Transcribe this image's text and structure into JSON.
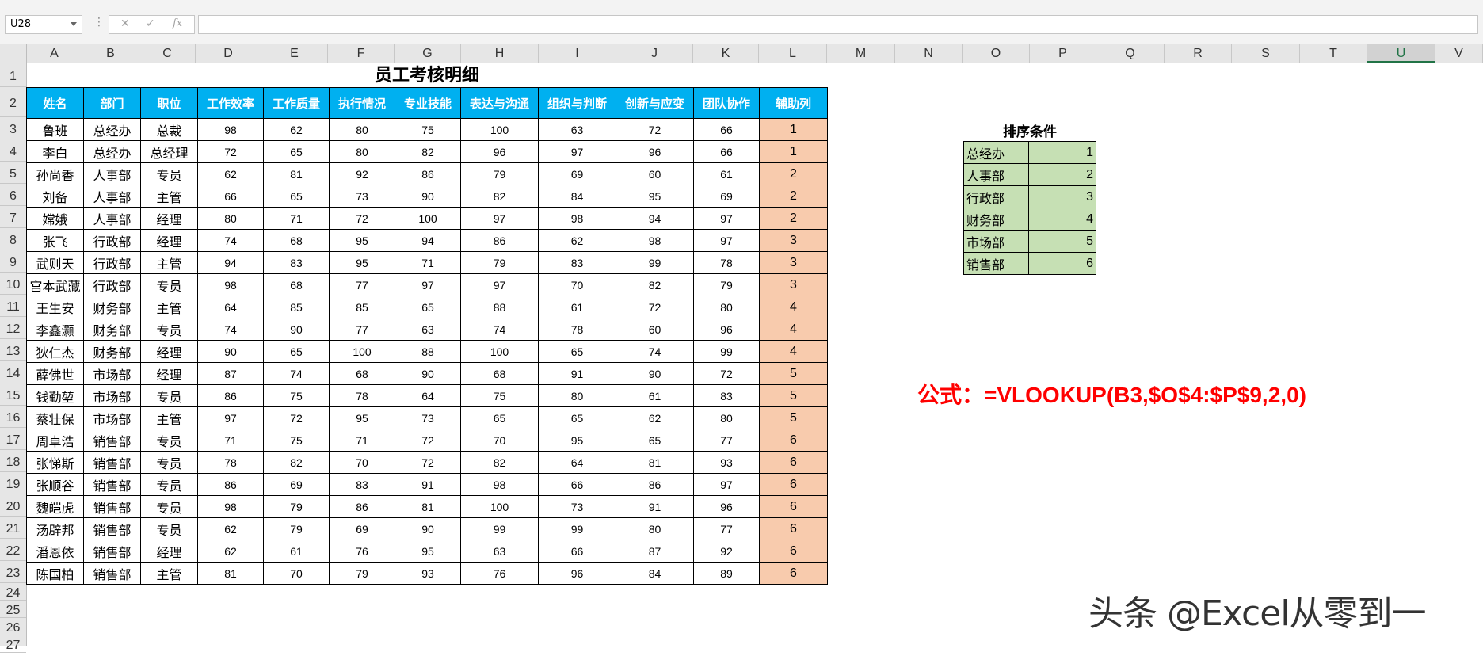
{
  "formula_bar": {
    "name_box": "U28",
    "cancel_icon": "✕",
    "enter_icon": "✓",
    "fx_label": "fx",
    "formula": ""
  },
  "columns": [
    "A",
    "B",
    "C",
    "D",
    "E",
    "F",
    "G",
    "H",
    "I",
    "J",
    "K",
    "L",
    "M",
    "N",
    "O",
    "P",
    "Q",
    "R",
    "S",
    "T",
    "U",
    "V"
  ],
  "selected_column": "U",
  "rows": [
    "1",
    "2",
    "3",
    "4",
    "5",
    "6",
    "7",
    "8",
    "9",
    "10",
    "11",
    "12",
    "13",
    "14",
    "15",
    "16",
    "17",
    "18",
    "19",
    "20",
    "21",
    "22",
    "23",
    "24",
    "25",
    "26",
    "27"
  ],
  "sheet": {
    "title": "员工考核明细",
    "headers": [
      "姓名",
      "部门",
      "职位",
      "工作效率",
      "工作质量",
      "执行情况",
      "专业技能",
      "表达与沟通",
      "组织与判断",
      "创新与应变",
      "团队协作",
      "辅助列"
    ],
    "records": [
      [
        "鲁班",
        "总经办",
        "总裁",
        "98",
        "62",
        "80",
        "75",
        "100",
        "63",
        "72",
        "66",
        "1"
      ],
      [
        "李白",
        "总经办",
        "总经理",
        "72",
        "65",
        "80",
        "82",
        "96",
        "97",
        "96",
        "66",
        "1"
      ],
      [
        "孙尚香",
        "人事部",
        "专员",
        "62",
        "81",
        "92",
        "86",
        "79",
        "69",
        "60",
        "61",
        "2"
      ],
      [
        "刘备",
        "人事部",
        "主管",
        "66",
        "65",
        "73",
        "90",
        "82",
        "84",
        "95",
        "69",
        "2"
      ],
      [
        "嫦娥",
        "人事部",
        "经理",
        "80",
        "71",
        "72",
        "100",
        "97",
        "98",
        "94",
        "97",
        "2"
      ],
      [
        "张飞",
        "行政部",
        "经理",
        "74",
        "68",
        "95",
        "94",
        "86",
        "62",
        "98",
        "97",
        "3"
      ],
      [
        "武则天",
        "行政部",
        "主管",
        "94",
        "83",
        "95",
        "71",
        "79",
        "83",
        "99",
        "78",
        "3"
      ],
      [
        "宫本武藏",
        "行政部",
        "专员",
        "98",
        "68",
        "77",
        "97",
        "97",
        "70",
        "82",
        "79",
        "3"
      ],
      [
        "王生安",
        "财务部",
        "主管",
        "64",
        "85",
        "85",
        "65",
        "88",
        "61",
        "72",
        "80",
        "4"
      ],
      [
        "李鑫灏",
        "财务部",
        "专员",
        "74",
        "90",
        "77",
        "63",
        "74",
        "78",
        "60",
        "96",
        "4"
      ],
      [
        "狄仁杰",
        "财务部",
        "经理",
        "90",
        "65",
        "100",
        "88",
        "100",
        "65",
        "74",
        "99",
        "4"
      ],
      [
        "薛佛世",
        "市场部",
        "经理",
        "87",
        "74",
        "68",
        "90",
        "68",
        "91",
        "90",
        "72",
        "5"
      ],
      [
        "钱勤堃",
        "市场部",
        "专员",
        "86",
        "75",
        "78",
        "64",
        "75",
        "80",
        "61",
        "83",
        "5"
      ],
      [
        "蔡壮保",
        "市场部",
        "主管",
        "97",
        "72",
        "95",
        "73",
        "65",
        "65",
        "62",
        "80",
        "5"
      ],
      [
        "周卓浩",
        "销售部",
        "专员",
        "71",
        "75",
        "71",
        "72",
        "70",
        "95",
        "65",
        "77",
        "6"
      ],
      [
        "张悌斯",
        "销售部",
        "专员",
        "78",
        "82",
        "70",
        "72",
        "82",
        "64",
        "81",
        "93",
        "6"
      ],
      [
        "张顺谷",
        "销售部",
        "专员",
        "86",
        "69",
        "83",
        "91",
        "98",
        "66",
        "86",
        "97",
        "6"
      ],
      [
        "魏皑虎",
        "销售部",
        "专员",
        "98",
        "79",
        "86",
        "81",
        "100",
        "73",
        "91",
        "96",
        "6"
      ],
      [
        "汤辟邦",
        "销售部",
        "专员",
        "62",
        "79",
        "69",
        "90",
        "99",
        "99",
        "80",
        "77",
        "6"
      ],
      [
        "潘恩依",
        "销售部",
        "经理",
        "62",
        "61",
        "76",
        "95",
        "63",
        "66",
        "87",
        "92",
        "6"
      ],
      [
        "陈国柏",
        "销售部",
        "主管",
        "81",
        "70",
        "79",
        "93",
        "76",
        "96",
        "84",
        "89",
        "6"
      ]
    ]
  },
  "sort_table": {
    "title": "排序条件",
    "rows": [
      [
        "总经办",
        "1"
      ],
      [
        "人事部",
        "2"
      ],
      [
        "行政部",
        "3"
      ],
      [
        "财务部",
        "4"
      ],
      [
        "市场部",
        "5"
      ],
      [
        "销售部",
        "6"
      ]
    ]
  },
  "formula_note": {
    "prefix": "公式：",
    "formula": "=VLOOKUP(B3,$O$4:$P$9,2,0)"
  },
  "watermark": "头条 @Excel从零到一",
  "colors": {
    "header_fill": "#00b0f0",
    "aux_fill": "#f8cbad",
    "sort_fill": "#c6e0b4",
    "formula_text": "#ff0000",
    "excel_green": "#217346"
  }
}
